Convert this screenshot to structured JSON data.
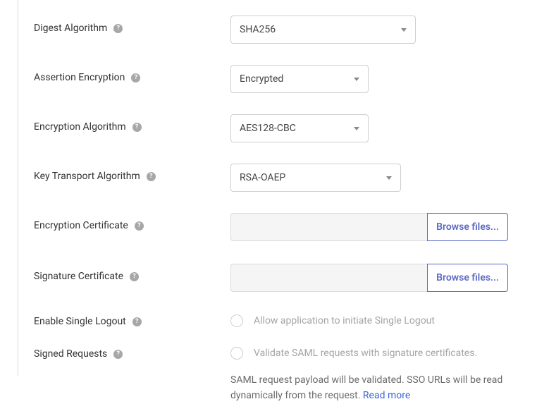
{
  "rows": {
    "digest": {
      "label": "Digest Algorithm",
      "value": "SHA256"
    },
    "assertion": {
      "label": "Assertion Encryption",
      "value": "Encrypted"
    },
    "encAlgo": {
      "label": "Encryption Algorithm",
      "value": "AES128-CBC"
    },
    "keyTransport": {
      "label": "Key Transport Algorithm",
      "value": "RSA-OAEP"
    },
    "encCert": {
      "label": "Encryption Certificate",
      "button": "Browse files..."
    },
    "sigCert": {
      "label": "Signature Certificate",
      "button": "Browse files..."
    },
    "eslo": {
      "label": "Enable Single Logout",
      "checkLabel": "Allow application to initiate Single Logout"
    },
    "signed": {
      "label": "Signed Requests",
      "checkLabel": "Validate SAML requests with signature certificates.",
      "desc": "SAML request payload will be validated. SSO URLs will be read dynamically from the request. ",
      "link": "Read more"
    }
  }
}
